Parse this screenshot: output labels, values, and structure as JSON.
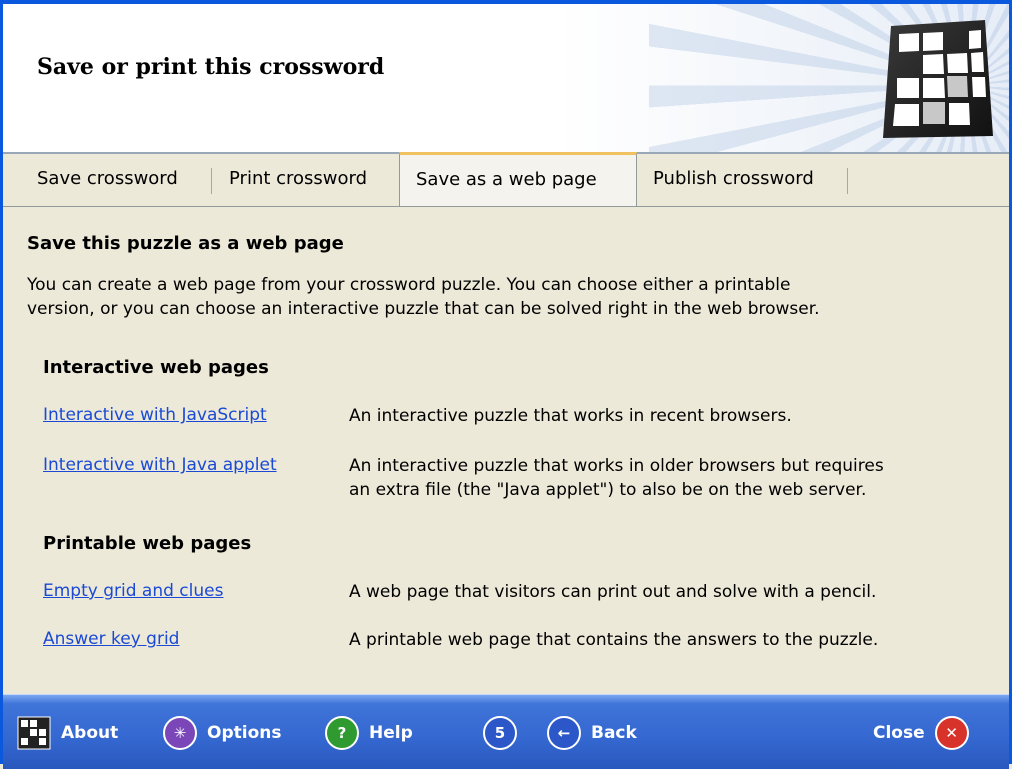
{
  "header": {
    "title": "Save or print this crossword"
  },
  "tabs": [
    {
      "label": "Save crossword"
    },
    {
      "label": "Print crossword"
    },
    {
      "label": "Save as a web page",
      "active": true
    },
    {
      "label": "Publish crossword"
    }
  ],
  "content": {
    "section_title": "Save this puzzle as a web page",
    "intro_line1": "You can create a web page from your crossword puzzle.  You can choose either a printable",
    "intro_line2": "version, or you can choose an interactive puzzle that can be solved right in the web browser.",
    "interactive": {
      "title": "Interactive web pages",
      "items": [
        {
          "link": "Interactive with JavaScript",
          "desc_line1": "An interactive puzzle that works in recent browsers.",
          "desc_line2": ""
        },
        {
          "link": "Interactive with Java applet",
          "desc_line1": "An interactive puzzle that works in older browsers but requires",
          "desc_line2": "an extra file (the \"Java applet\") to also be on the web server."
        }
      ]
    },
    "printable": {
      "title": "Printable web pages",
      "items": [
        {
          "link": "Empty grid and clues",
          "desc_line1": "A web page that visitors can print out and solve with a pencil."
        },
        {
          "link": "Answer key grid",
          "desc_line1": "A printable web page that contains the answers to the puzzle."
        }
      ]
    }
  },
  "footer": {
    "about": "About",
    "options": "Options",
    "help": "Help",
    "back": "Back",
    "close": "Close",
    "icons": {
      "about": "crossword-grid-icon",
      "options": "options-star-icon",
      "help": "help-question-icon",
      "history": "history-five-icon",
      "back": "back-arrow-icon",
      "close": "close-x-icon"
    }
  },
  "colors": {
    "accent_blue": "#0a58de",
    "footer_blue": "#3467d0",
    "link": "#1a49d6",
    "active_tab_highlight": "#f0c160",
    "close_red": "#d8332a",
    "options_purple": "#7a46b8",
    "help_green": "#2f9a2f"
  }
}
